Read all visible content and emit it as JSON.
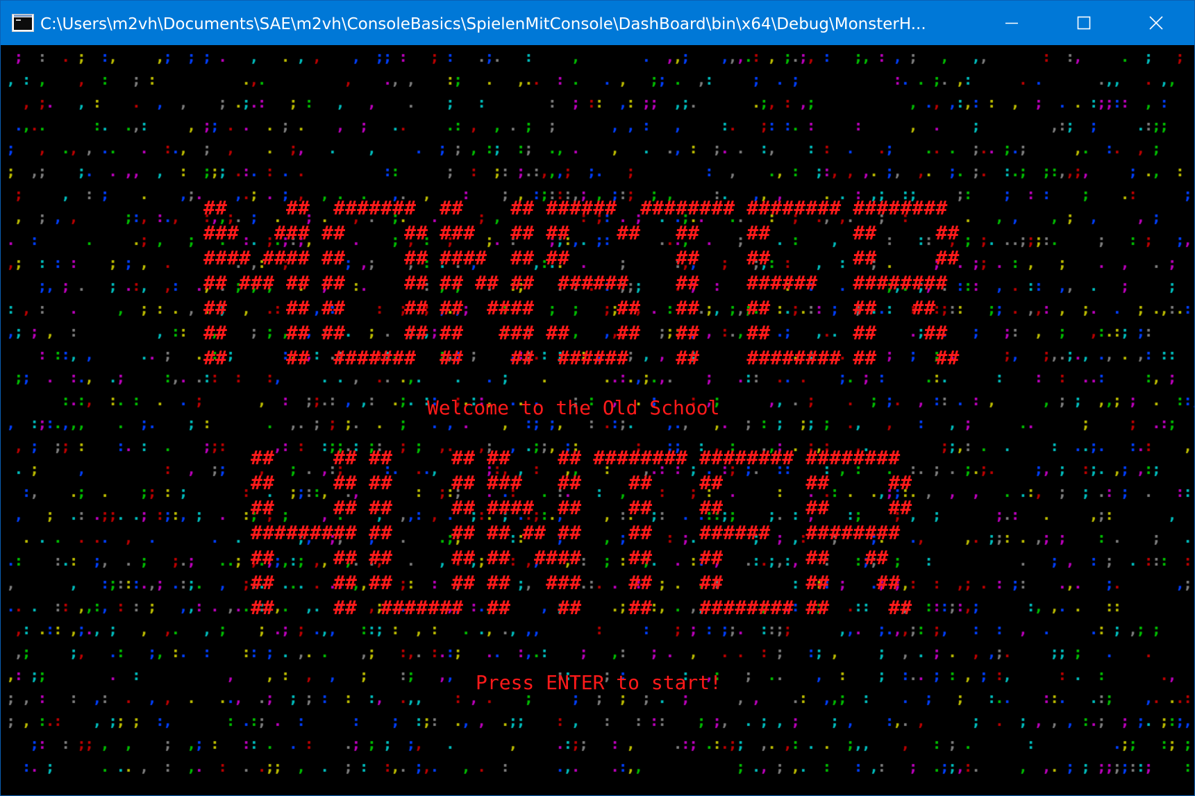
{
  "window": {
    "title": "C:\\Users\\m2vh\\Documents\\SAE\\m2vh\\ConsoleBasics\\SpielenMitConsole\\DashBoard\\bin\\x64\\Debug\\MonsterH...",
    "icon": "console-app-icon",
    "titlebar_color": "#0078d7",
    "controls": [
      "minimize-icon",
      "maximize-icon",
      "close-icon"
    ]
  },
  "console": {
    "background_color": "#000000",
    "text_color": "#ff1a1a",
    "banner_top": [
      "##     ##  #######  ##    ## ######  ######## ######## ########",
      "###   ### ##     ## ###   ## ##    ##   ##    ##       ##     ##",
      "#### #### ##     ## ####  ## ##         ##    ##       ##     ##",
      "## ### ## ##     ## ## ## ##  ######    ##    ######   ########",
      "##     ## ##     ## ##  ####       ##   ##    ##       ##   ##",
      "##     ## ##     ## ##   ### ##    ##   ##    ##       ##    ##",
      "##     ##  #######  ##    ##  ######    ##    ######## ##     ##"
    ],
    "welcome_text": "Welcome to the Old School",
    "banner_bottom": [
      "##     ## ##     ## ##    ## ######## ######## ########",
      "##     ## ##     ## ###   ##    ##    ##       ##     ##",
      "##     ## ##     ## ####  ##    ##    ##       ##     ##",
      "######### ##     ## ## ## ##    ##    ######   ########",
      "##     ## ##     ## ##  ####    ##    ##       ##   ##",
      "##     ## ##     ## ##   ###    ##    ##       ##    ##",
      "##     ##  #######  ##    ##    ##    ######## ##     ##"
    ],
    "prompt_text": "Press ENTER to start!",
    "noise_glyphs": [
      ".",
      ",",
      ":",
      ";"
    ],
    "noise_colors": [
      "#00c000",
      "#c0c000",
      "#00c0c0",
      "#0040ff",
      "#c000c0",
      "#c00000",
      "#808080"
    ]
  }
}
